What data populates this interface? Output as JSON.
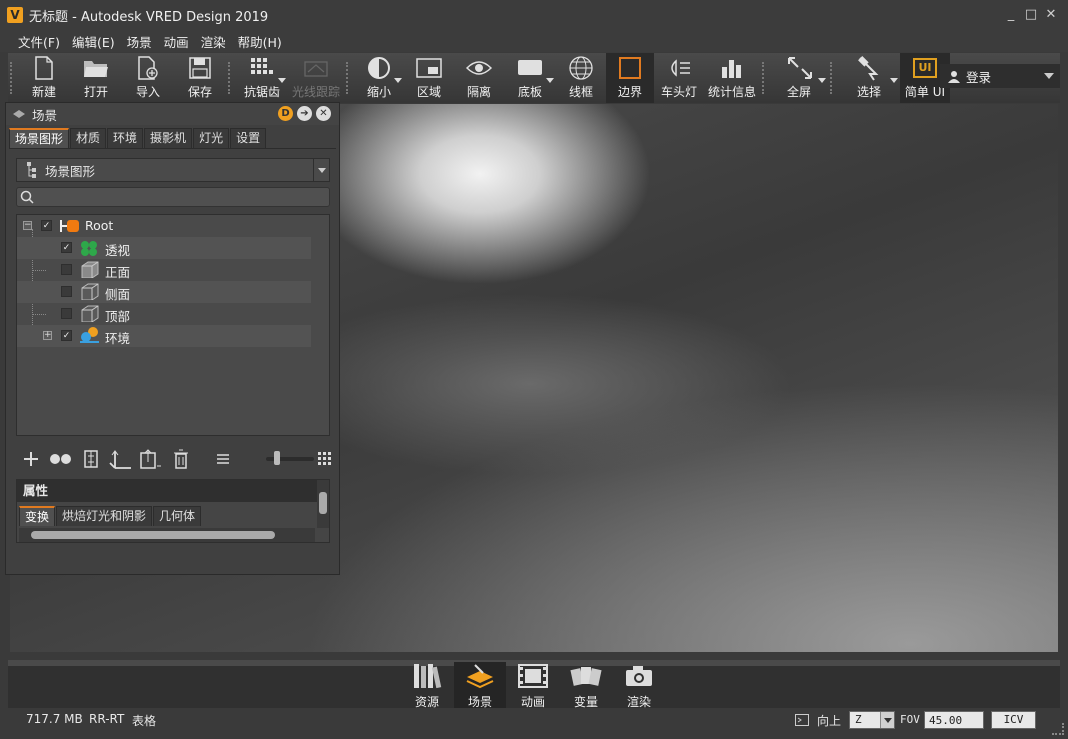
{
  "window": {
    "title": "无标题 - Autodesk VRED Design 2019",
    "logo_letter": "V",
    "minimize": "_",
    "maximize": "□",
    "close": "✕"
  },
  "menu": [
    "文件(F)",
    "编辑(E)",
    "场景",
    "动画",
    "渲染",
    "帮助(H)"
  ],
  "toolbar": {
    "new": "新建",
    "open": "打开",
    "import": "导入",
    "save": "保存",
    "antialias": "抗锯齿",
    "raytracing": "光线跟踪",
    "zoom_out": "缩小",
    "region": "区域",
    "isolate": "隔离",
    "floor": "底板",
    "wireframe": "线框",
    "bounds": "边界",
    "headlight": "车头灯",
    "statistics": "统计信息",
    "fullscreen": "全屏",
    "select": "选择",
    "simple_ui": "简单 UI",
    "ui_badge": "UI",
    "login": "登录"
  },
  "scene_panel": {
    "title": "场景",
    "tabs": [
      "场景图形",
      "材质",
      "环境",
      "摄影机",
      "灯光",
      "设置"
    ],
    "active_tab": 0,
    "dropdown_value": "场景图形",
    "search_placeholder": "",
    "tree": [
      {
        "label": "Root",
        "checked": true,
        "expander": "−"
      },
      {
        "label": "透视",
        "checked": true
      },
      {
        "label": "正面",
        "checked": false
      },
      {
        "label": "侧面",
        "checked": false
      },
      {
        "label": "顶部",
        "checked": false
      },
      {
        "label": "环境",
        "checked": true,
        "expander": "+"
      }
    ],
    "properties_title": "属性",
    "properties_tabs": [
      "变换",
      "烘焙灯光和阴影",
      "几何体"
    ],
    "properties_active_tab": 0
  },
  "modules": [
    "资源",
    "场景",
    "动画",
    "变量",
    "渲染"
  ],
  "active_module": 1,
  "status": {
    "memory": "717.7 MB",
    "mode": "RR-RT",
    "table": "表格",
    "up_label": "向上",
    "up_value": "Z",
    "fov_label": "FOV",
    "fov_value": "45.00",
    "icv": "ICV"
  },
  "colors": {
    "accent": "#e07a20",
    "ui_background": "#3a3a3a"
  }
}
